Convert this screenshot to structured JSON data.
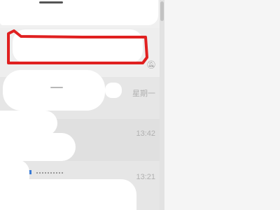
{
  "conversation_list": {
    "items": [
      {
        "time": "星期一"
      },
      {
        "time": "13:42"
      },
      {
        "time": "13:21"
      }
    ]
  },
  "annotation": {
    "color": "#e02020"
  }
}
